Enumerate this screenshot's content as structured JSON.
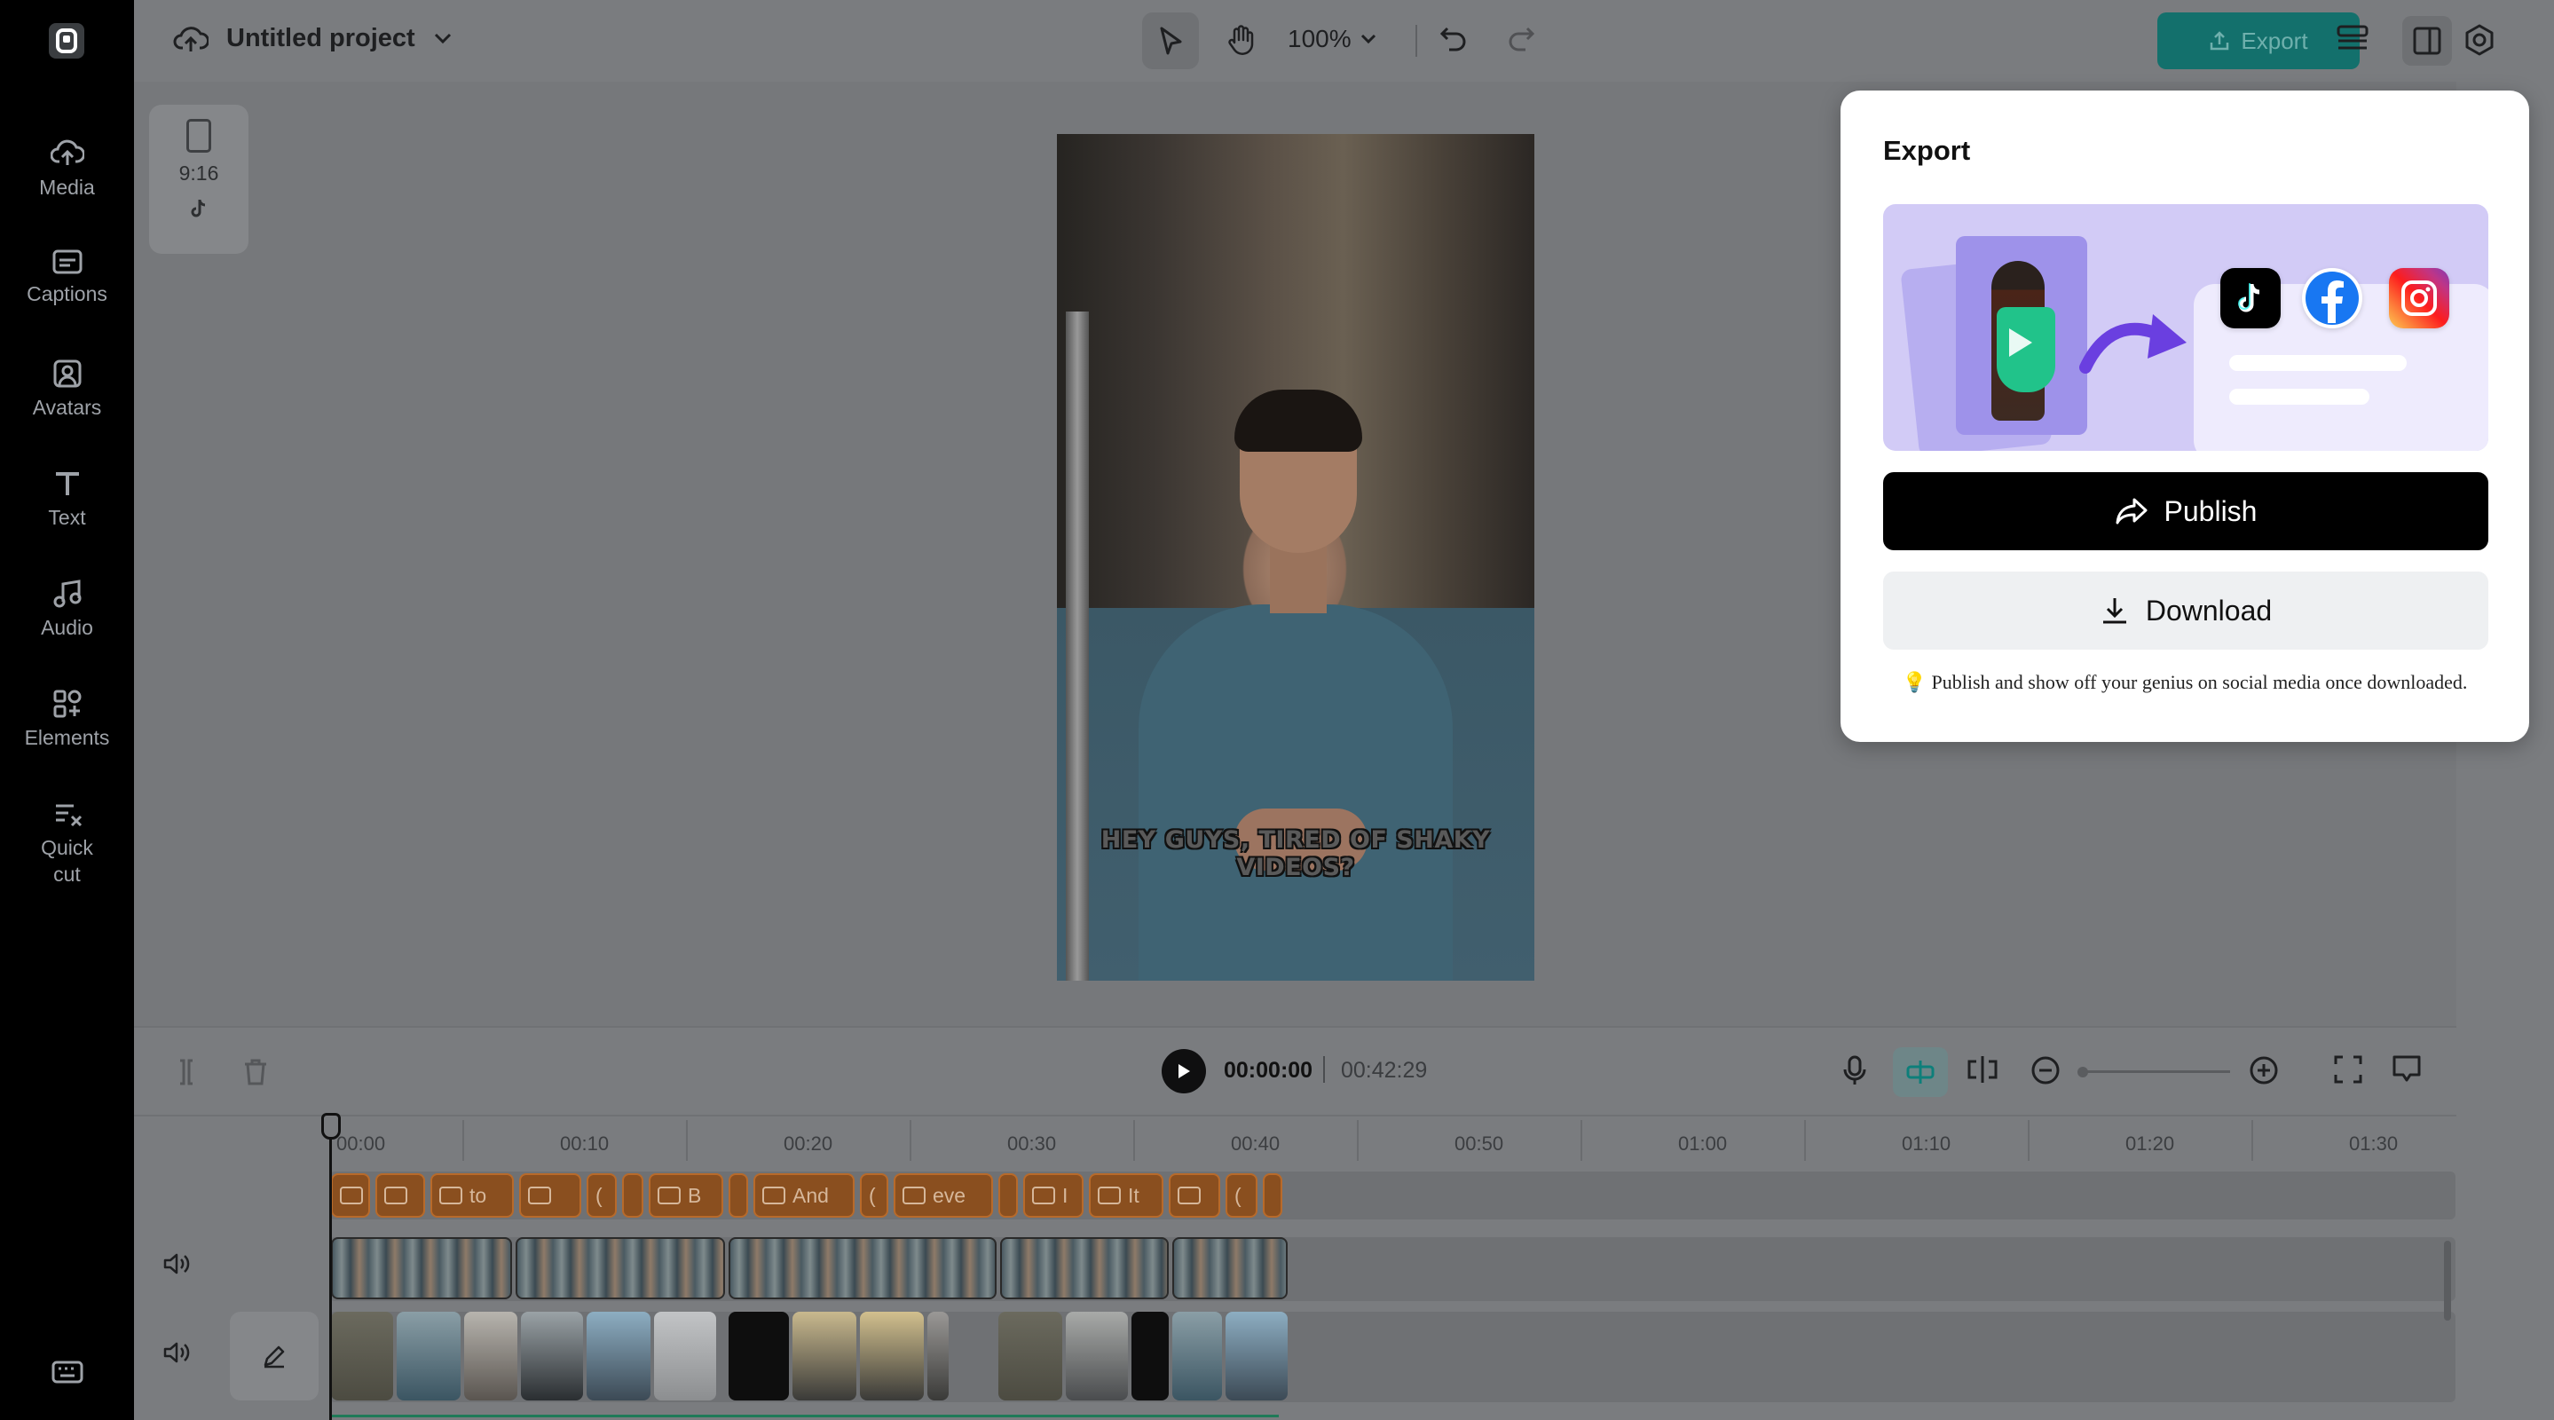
{
  "project": {
    "title": "Untitled project"
  },
  "toolbar": {
    "zoom": "100%",
    "export_label": "Export"
  },
  "sidebar": {
    "items": [
      {
        "label": "Media",
        "icon": "cloud-upload-icon"
      },
      {
        "label": "Captions",
        "icon": "captions-icon"
      },
      {
        "label": "Avatars",
        "icon": "avatar-icon"
      },
      {
        "label": "Text",
        "icon": "text-icon"
      },
      {
        "label": "Audio",
        "icon": "music-icon"
      },
      {
        "label": "Elements",
        "icon": "elements-icon"
      },
      {
        "label": "Quick\ncut",
        "icon": "quick-cut-icon"
      }
    ]
  },
  "canvas": {
    "ratio": "9:16",
    "subtitle": "HEY GUYS, TIRED OF SHAKY VIDEOS?"
  },
  "timeline": {
    "current_time": "00:00:00",
    "total_time": "00:42:29",
    "ticks": [
      "00:00",
      "00:10",
      "00:20",
      "00:30",
      "00:40",
      "00:50",
      "01:00",
      "01:10",
      "01:20",
      "01:30"
    ],
    "caption_chips": [
      "",
      "",
      "to",
      "",
      "(",
      "",
      "B",
      "",
      "And",
      "(",
      "eve",
      "",
      "I",
      "It",
      "",
      "("
    ]
  },
  "export_panel": {
    "title": "Export",
    "publish_label": "Publish",
    "download_label": "Download",
    "tip": "💡 Publish and show off your genius on social media once downloaded."
  },
  "colors": {
    "accent": "#13706c",
    "caption_chip": "#8a4f1f",
    "hero_bg": "#d2cbf6"
  }
}
